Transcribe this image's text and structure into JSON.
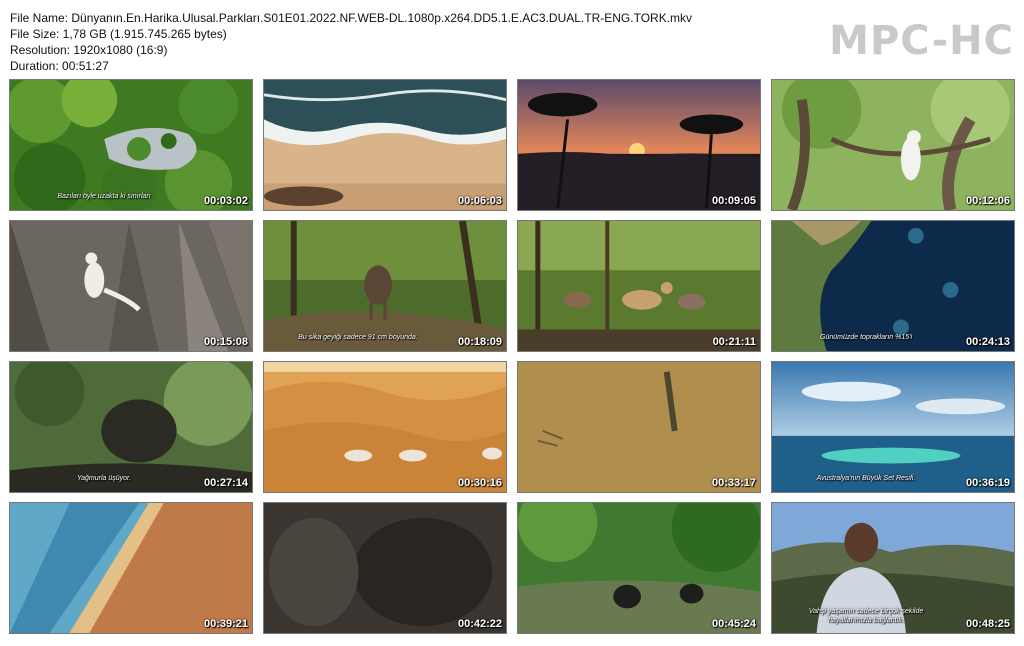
{
  "info": {
    "file_name": "File Name: Dünyanın.En.Harika.Ulusal.Parkları.S01E01.2022.NF.WEB-DL.1080p.x264.DD5.1.E.AC3.DUAL.TR-ENG.TORK.mkv",
    "file_size": "File Size: 1,78 GB (1.915.745.265 bytes)",
    "resolution": "Resolution: 1920x1080 (16:9)",
    "duration": "Duration: 00:51:27"
  },
  "logo": "MPC-HC",
  "thumbnails": [
    {
      "time": "00:03:02",
      "subtitle": "Bazıları öyle uzakta ki sınırları"
    },
    {
      "time": "00:06:03",
      "subtitle": ""
    },
    {
      "time": "00:09:05",
      "subtitle": ""
    },
    {
      "time": "00:12:06",
      "subtitle": ""
    },
    {
      "time": "00:15:08",
      "subtitle": ""
    },
    {
      "time": "00:18:09",
      "subtitle": "Bu sika geyiği sadece 91 cm boyunda."
    },
    {
      "time": "00:21:11",
      "subtitle": ""
    },
    {
      "time": "00:24:13",
      "subtitle": "Günümüzde toprakların %15'i"
    },
    {
      "time": "00:27:14",
      "subtitle": "Yağmurla üşüyor."
    },
    {
      "time": "00:30:16",
      "subtitle": ""
    },
    {
      "time": "00:33:17",
      "subtitle": ""
    },
    {
      "time": "00:36:19",
      "subtitle": "Avustralya'nın Büyük Set Resifi."
    },
    {
      "time": "00:39:21",
      "subtitle": ""
    },
    {
      "time": "00:42:22",
      "subtitle": ""
    },
    {
      "time": "00:45:24",
      "subtitle": ""
    },
    {
      "time": "00:48:25",
      "subtitle": "Vahşi yaşamın sadece birçok şekilde",
      "subtitle2": "hayatlarımızla bağlantılı."
    }
  ]
}
